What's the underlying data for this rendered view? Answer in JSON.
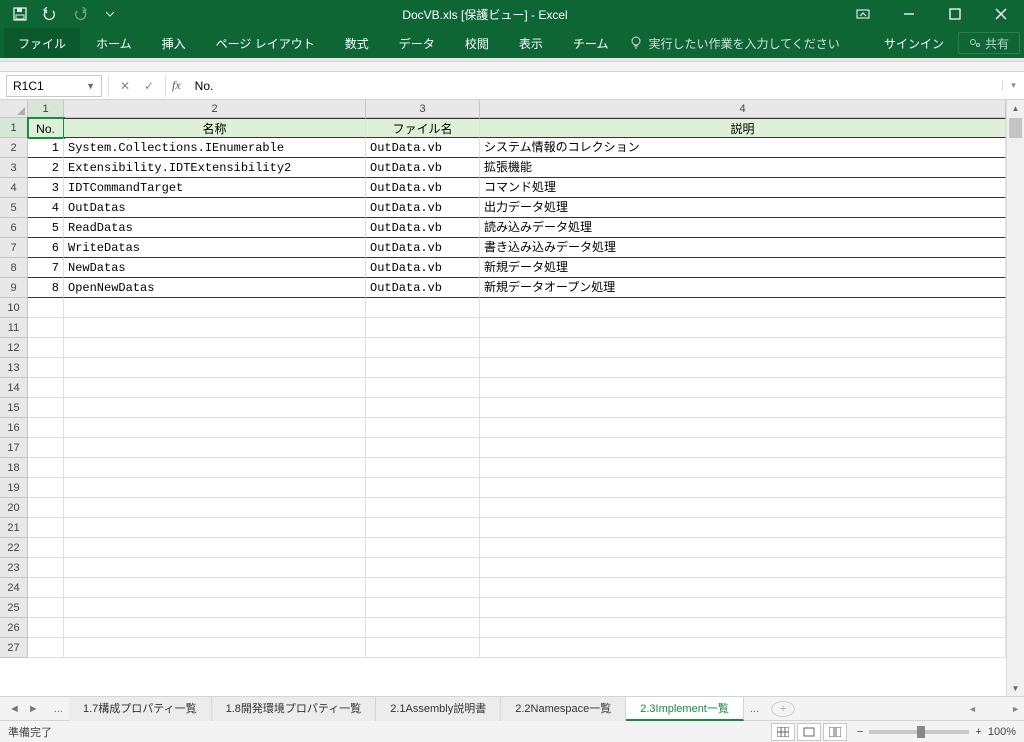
{
  "window": {
    "title": "DocVB.xls [保護ビュー] - Excel"
  },
  "ribbon": {
    "tabs": [
      "ファイル",
      "ホーム",
      "挿入",
      "ページ レイアウト",
      "数式",
      "データ",
      "校閲",
      "表示",
      "チーム"
    ],
    "tellme": "実行したい作業を入力してください",
    "signin": "サインイン",
    "share": "共有"
  },
  "formula": {
    "namebox": "R1C1",
    "fx": "fx",
    "value": "No."
  },
  "sheet": {
    "col_labels": [
      "1",
      "2",
      "3",
      "4"
    ],
    "header": {
      "no": "No.",
      "name": "名称",
      "file": "ファイル名",
      "desc": "説明"
    },
    "rows": [
      {
        "no": "1",
        "name": "System.Collections.IEnumerable",
        "file": "OutData.vb",
        "desc": "システム情報のコレクション"
      },
      {
        "no": "2",
        "name": "Extensibility.IDTExtensibility2",
        "file": "OutData.vb",
        "desc": "拡張機能"
      },
      {
        "no": "3",
        "name": "IDTCommandTarget",
        "file": "OutData.vb",
        "desc": "コマンド処理"
      },
      {
        "no": "4",
        "name": "OutDatas",
        "file": "OutData.vb",
        "desc": "出力データ処理"
      },
      {
        "no": "5",
        "name": "ReadDatas",
        "file": "OutData.vb",
        "desc": "読み込みデータ処理"
      },
      {
        "no": "6",
        "name": "WriteDatas",
        "file": "OutData.vb",
        "desc": "書き込み込みデータ処理"
      },
      {
        "no": "7",
        "name": "NewDatas",
        "file": "OutData.vb",
        "desc": "新規データ処理"
      },
      {
        "no": "8",
        "name": "OpenNewDatas",
        "file": "OutData.vb",
        "desc": "新規データオープン処理"
      }
    ],
    "empty_rows_start": 10,
    "empty_rows_end": 27
  },
  "tabs": {
    "dots": "...",
    "items": [
      "1.7構成プロパティ一覧",
      "1.8開発環境プロパティ一覧",
      "2.1Assembly説明書",
      "2.2Namespace一覧",
      "2.3Implement一覧"
    ],
    "active_index": 4,
    "trail_dots": "..."
  },
  "status": {
    "ready": "準備完了",
    "zoom": "100%",
    "minus": "−",
    "plus": "+"
  }
}
